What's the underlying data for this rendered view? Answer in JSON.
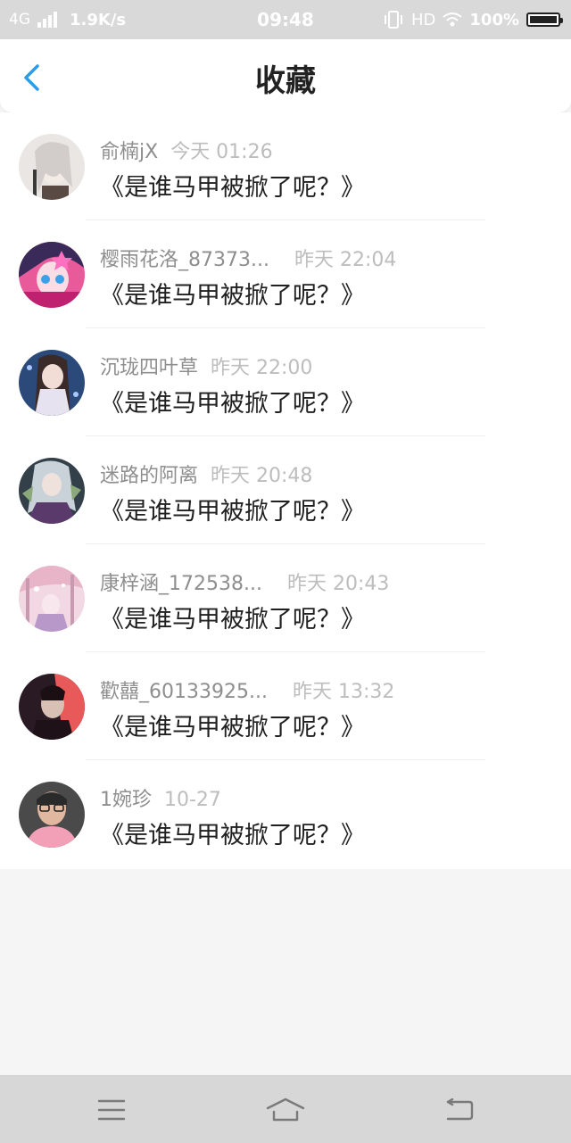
{
  "status_bar": {
    "network": "4G",
    "speed": "1.9K/s",
    "time": "09:48",
    "hd": "HD",
    "battery": "100%"
  },
  "header": {
    "title": "收藏",
    "back_icon": "chevron-left-icon"
  },
  "colors": {
    "accent": "#2e9bea",
    "status_bar_bg": "#d9d9d9",
    "nav_bar_bg": "#d7d7d7"
  },
  "favorites": [
    {
      "user": "俞楠jX",
      "time": "今天 01:26",
      "title": "《是谁马甲被掀了呢？》"
    },
    {
      "user": "樱雨花洛_87373...",
      "time": "昨天 22:04",
      "title": "《是谁马甲被掀了呢？》"
    },
    {
      "user": "沉珑四叶草",
      "time": "昨天 22:00",
      "title": "《是谁马甲被掀了呢？》"
    },
    {
      "user": "迷路的阿离",
      "time": "昨天 20:48",
      "title": "《是谁马甲被掀了呢？》"
    },
    {
      "user": "康梓涵_172538...",
      "time": "昨天 20:43",
      "title": "《是谁马甲被掀了呢？》"
    },
    {
      "user": "歡囍_60133925...",
      "time": "昨天 13:32",
      "title": "《是谁马甲被掀了呢？》"
    },
    {
      "user": "1婉珍",
      "time": "10-27",
      "title": "《是谁马甲被掀了呢？》"
    }
  ],
  "nav_bar": {
    "menu_icon": "menu-icon",
    "home_icon": "home-icon",
    "back_icon": "back-icon"
  }
}
